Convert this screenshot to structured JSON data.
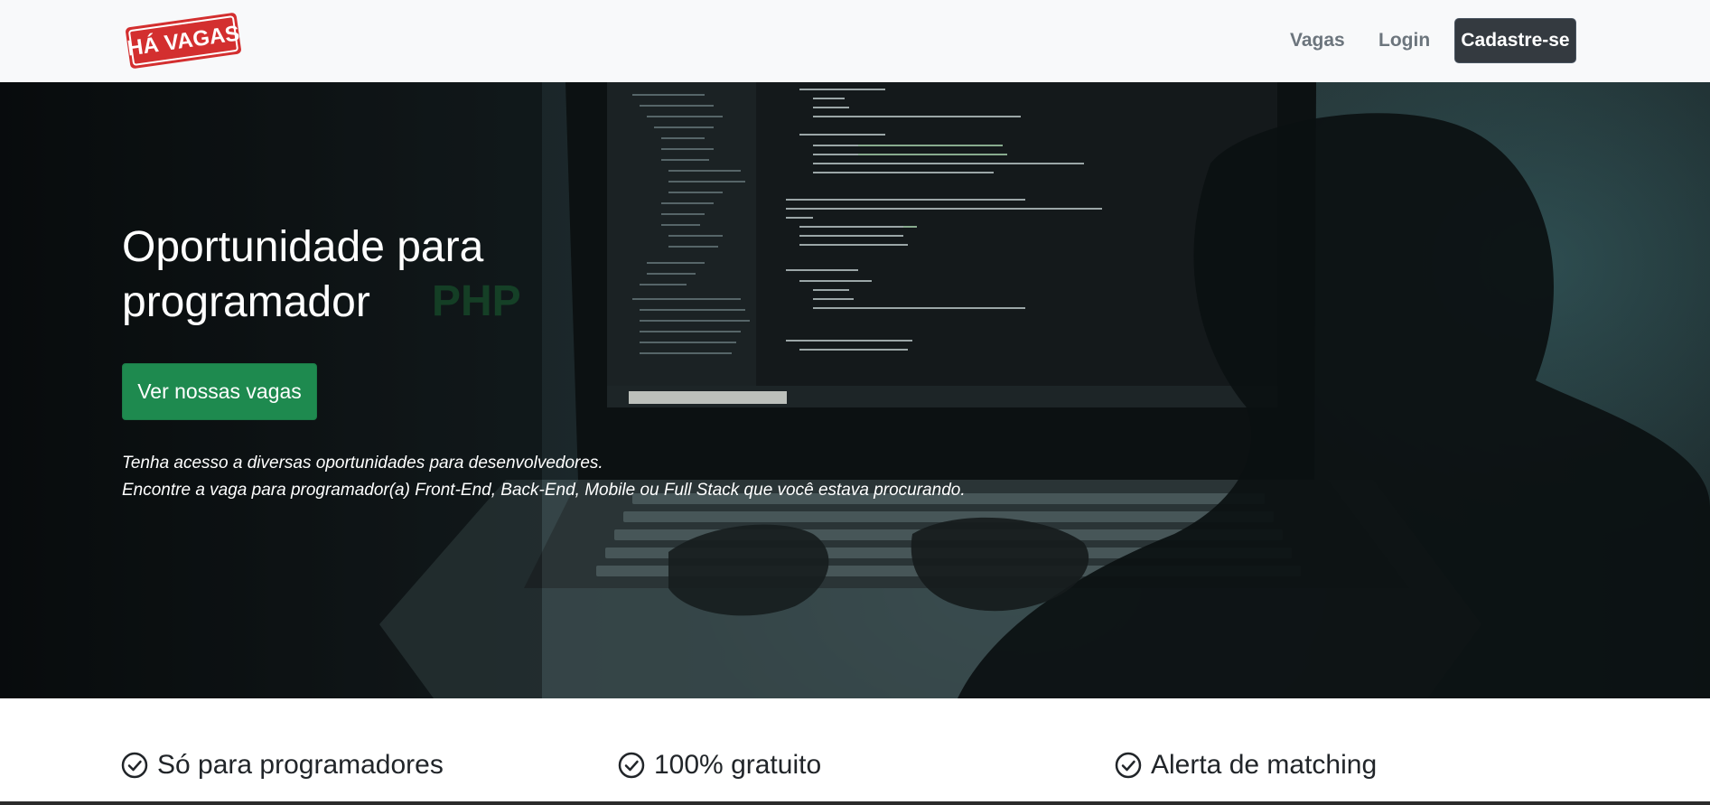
{
  "navbar": {
    "logo_text": "HÁ VAGAS",
    "links": {
      "vagas": "Vagas",
      "login": "Login"
    },
    "signup_label": "Cadastre-se"
  },
  "hero": {
    "title_line1": "Oportunidade para",
    "title_line2": "programador",
    "highlight_word": "PHP",
    "cta_label": "Ver nossas vagas",
    "subtitle_line1": "Tenha acesso a diversas oportunidades para desenvolvedores.",
    "subtitle_line2": "Encontre a vaga para programador(a) Front-End, Back-End, Mobile ou Full Stack que você estava procurando."
  },
  "features": [
    {
      "label": "Só para programadores",
      "icon": "check-circle-icon"
    },
    {
      "label": "100% gratuito",
      "icon": "check-circle-icon"
    },
    {
      "label": "Alerta de matching",
      "icon": "check-circle-icon"
    }
  ],
  "colors": {
    "navbar_bg": "#f8f9fa",
    "signup_bg": "#343a40",
    "cta_bg": "#1e8a4f",
    "logo_red": "#d32f2f"
  }
}
